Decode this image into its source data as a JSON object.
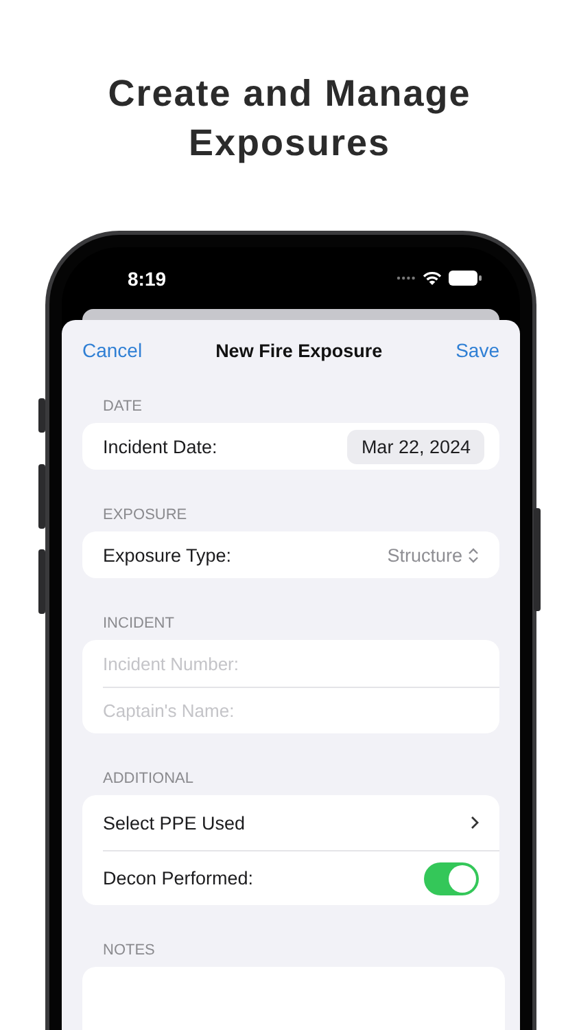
{
  "headline": [
    "Create and Manage",
    "Exposures"
  ],
  "status_bar": {
    "time": "8:19"
  },
  "nav": {
    "cancel": "Cancel",
    "title": "New Fire Exposure",
    "save": "Save"
  },
  "sections": [
    {
      "header": "DATE",
      "rows": [
        {
          "kind": "date",
          "label": "Incident Date:",
          "value": "Mar 22, 2024"
        }
      ]
    },
    {
      "header": "EXPOSURE",
      "rows": [
        {
          "kind": "picker",
          "label": "Exposure Type:",
          "value": "Structure"
        }
      ]
    },
    {
      "header": "INCIDENT",
      "rows": [
        {
          "kind": "text",
          "placeholder": "Incident Number:"
        },
        {
          "kind": "text",
          "placeholder": "Captain's Name:"
        }
      ]
    },
    {
      "header": "ADDITIONAL",
      "rows": [
        {
          "kind": "link",
          "label": "Select PPE Used"
        },
        {
          "kind": "toggle",
          "label": "Decon Performed:",
          "on": true
        }
      ]
    },
    {
      "header": "NOTES",
      "rows": [
        {
          "kind": "notes"
        }
      ]
    }
  ]
}
